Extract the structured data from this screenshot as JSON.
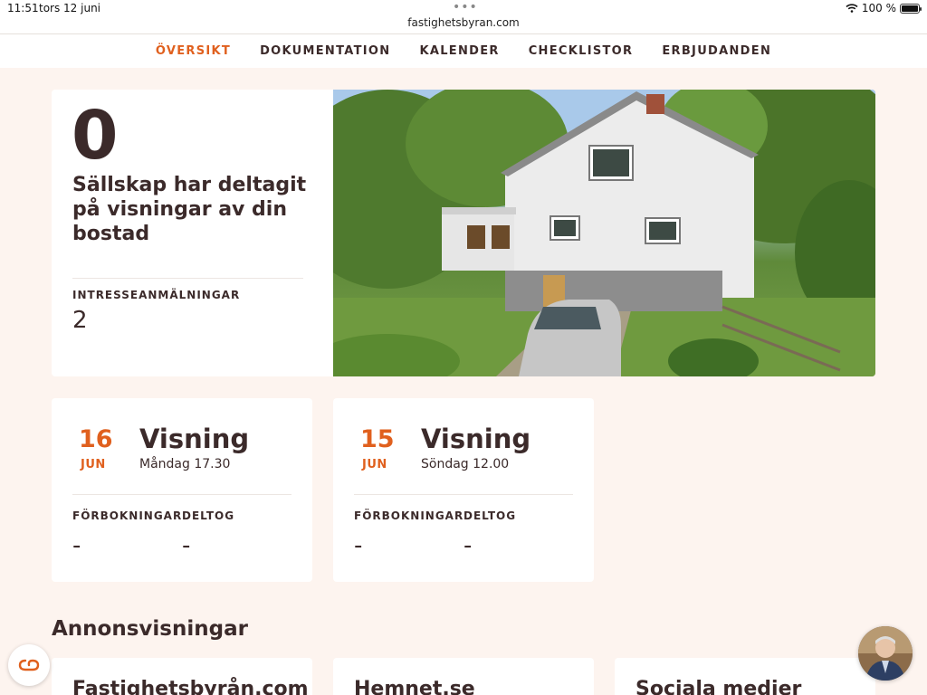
{
  "status_bar": {
    "time": "11:51",
    "date": "tors 12 juni",
    "url": "fastighetsbyran.com",
    "battery": "100 %"
  },
  "nav": {
    "items": [
      {
        "label": "ÖVERSIKT",
        "active": true
      },
      {
        "label": "DOKUMENTATION",
        "active": false
      },
      {
        "label": "KALENDER",
        "active": false
      },
      {
        "label": "CHECKLISTOR",
        "active": false
      },
      {
        "label": "ERBJUDANDEN",
        "active": false
      }
    ],
    "active_color": "#e0601e"
  },
  "stats": {
    "count": "0",
    "description": "Sällskap har deltagit på visningar av din bostad",
    "interest_label": "INTRESSEANMÄLNINGAR",
    "interest_value": "2"
  },
  "events": [
    {
      "day": "16",
      "month": "JUN",
      "title": "Visning",
      "subtitle": "Måndag 17.30",
      "bookings_label": "FÖRBOKNINGAR",
      "bookings_value": "-",
      "attended_label": "DELTOG",
      "attended_value": "-"
    },
    {
      "day": "15",
      "month": "JUN",
      "title": "Visning",
      "subtitle": "Söndag 12.00",
      "bookings_label": "FÖRBOKNINGAR",
      "bookings_value": "-",
      "attended_label": "DELTOG",
      "attended_value": "-"
    }
  ],
  "ads_section": {
    "title": "Annonsvisningar",
    "cards": [
      {
        "title": "Fastighetsbyrån.com"
      },
      {
        "title": "Hemnet.se"
      },
      {
        "title": "Sociala medier"
      }
    ]
  },
  "colors": {
    "accent": "#e0601e",
    "text": "#3b2a2a",
    "background": "#fdf4ef"
  }
}
